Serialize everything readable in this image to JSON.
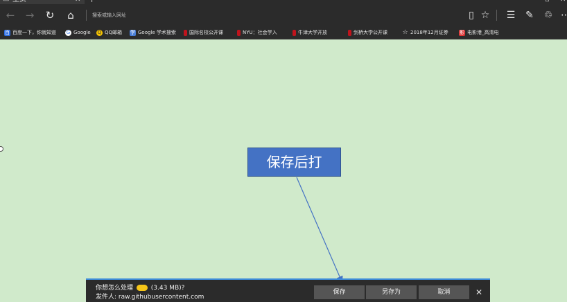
{
  "tab": {
    "icon": "page-icon",
    "title": "主页",
    "close_glyph": "✕"
  },
  "newtab_glyph": "+",
  "window_controls": {
    "minimize": "—",
    "maximize": "▫",
    "close": "✕"
  },
  "nav": {
    "back_glyph": "←",
    "forward_glyph": "→",
    "refresh_glyph": "↻",
    "home_glyph": "⌂",
    "address_placeholder": "搜索或输入网址"
  },
  "toolbar": {
    "reading_view_glyph": "▯",
    "favorite_glyph": "☆",
    "hub_glyph": "☰",
    "notes_glyph": "✎",
    "share_glyph": "♲",
    "more_glyph": "⋯"
  },
  "favorites": [
    {
      "icon": "baidu-icon",
      "color": "#2f6fe4",
      "glyph": "百",
      "label": "百度一下，你就知道"
    },
    {
      "icon": "google-icon",
      "color": "#ffffff",
      "glyph": "G",
      "label": "Google"
    },
    {
      "icon": "qq-mail-icon",
      "color": "#f6c400",
      "glyph": "Q",
      "label": "QQ邮箱"
    },
    {
      "icon": "google-scholar-icon",
      "color": "#4a7fd8",
      "glyph": "学",
      "label": "Google 学术搜索"
    },
    {
      "icon": "bookmark-red-icon",
      "color": "#c0141c",
      "glyph": "",
      "label": "国际名校公开课"
    },
    {
      "icon": "bookmark-red-icon",
      "color": "#c0141c",
      "glyph": "",
      "label": "NYU：社会学入"
    },
    {
      "icon": "bookmark-red-icon",
      "color": "#c0141c",
      "glyph": "",
      "label": "牛津大学开放"
    },
    {
      "icon": "bookmark-red-icon",
      "color": "#c0141c",
      "glyph": "",
      "label": "剑桥大学公开课"
    },
    {
      "icon": "star-icon",
      "color": "transparent",
      "glyph": "☆",
      "label": "2018年12月证券"
    },
    {
      "icon": "movie-icon",
      "color": "#d33",
      "glyph": "影",
      "label": "电影港_高清电"
    }
  ],
  "callout": {
    "text": "保存后打"
  },
  "download": {
    "prompt_prefix": "你想怎么处理",
    "file_size": "(3.43 MB)?",
    "sender": "发件人: raw.githubusercontent.com",
    "save_label": "保存",
    "save_as_label": "另存为",
    "cancel_label": "取消",
    "close_glyph": "✕",
    "accent_color": "#3c8bd9"
  }
}
